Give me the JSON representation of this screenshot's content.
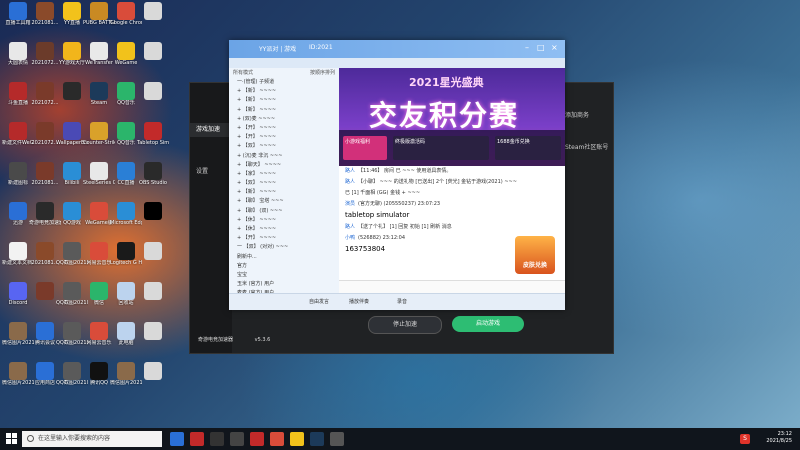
{
  "desktop": {
    "icons": [
      {
        "label": "直播工具箱",
        "color": "#2a6fd6"
      },
      {
        "label": "2021081...",
        "color": "#8a4a2a"
      },
      {
        "label": "YY直播",
        "color": "#f2c21b"
      },
      {
        "label": "PUBG BATTLEGR...",
        "color": "#c98a23"
      },
      {
        "label": "Google Chrome",
        "color": "#d94c3a"
      },
      {
        "label": "",
        "color": "#d9d9d9"
      },
      {
        "label": "大圆表情",
        "color": "#e8e8e8"
      },
      {
        "label": "2021072...",
        "color": "#6b3b2a"
      },
      {
        "label": "YY游戏大厅",
        "color": "#f2b51b"
      },
      {
        "label": "WeTransfer",
        "color": "#e9e9e9"
      },
      {
        "label": "WeGame",
        "color": "#f2c21b"
      },
      {
        "label": "",
        "color": "#d9d9d9"
      },
      {
        "label": "斗鱼直播",
        "color": "#b52a2a"
      },
      {
        "label": "2021072...",
        "color": "#7a3a2a"
      },
      {
        "label": "",
        "color": "#2a2a2a"
      },
      {
        "label": "Steam",
        "color": "#1c3a5a"
      },
      {
        "label": "QQ音乐",
        "color": "#2bb56b"
      },
      {
        "label": "",
        "color": "#d9d9d9"
      },
      {
        "label": "新建文件WeGame",
        "color": "#b52a2a"
      },
      {
        "label": "2021072...",
        "color": "#7a3a2a"
      },
      {
        "label": "WallpaperEngine",
        "color": "#4a4ab5"
      },
      {
        "label": "Counter-Strike",
        "color": "#d9a12a"
      },
      {
        "label": "QQ音乐",
        "color": "#2bb56b"
      },
      {
        "label": "Tabletop Simulator",
        "color": "#c22a2a"
      },
      {
        "label": "新建图标",
        "color": "#4a4a4a"
      },
      {
        "label": "2021081...",
        "color": "#7a3a2a"
      },
      {
        "label": "Bilibili",
        "color": "#2a8ed6"
      },
      {
        "label": "SteelSeries GG",
        "color": "#e8e8e8"
      },
      {
        "label": "CC直播",
        "color": "#2a7fd6"
      },
      {
        "label": "OBS Studio",
        "color": "#2a2a2a"
      },
      {
        "label": "迅游",
        "color": "#2a6fd6"
      },
      {
        "label": "奇游电竞加速器",
        "color": "#2a2a2a"
      },
      {
        "label": "QQ游戏",
        "color": "#2a8ed6"
      },
      {
        "label": "WeGame版",
        "color": "#d94c3a"
      },
      {
        "label": "Microsoft Edge",
        "color": "#2a8ed6"
      },
      {
        "label": "",
        "color": "#000000"
      },
      {
        "label": "新建文本文档.txt",
        "color": "#f2f2f2"
      },
      {
        "label": "2021081...",
        "color": "#8a4a2a"
      },
      {
        "label": "QQ截图2021081...",
        "color": "#5a5a5a"
      },
      {
        "label": "网易云音乐",
        "color": "#d94c3a"
      },
      {
        "label": "Logitech G HUB",
        "color": "#1a1a1a"
      },
      {
        "label": "",
        "color": "#d9d9d9"
      },
      {
        "label": "Discord",
        "color": "#5865f2"
      },
      {
        "label": "",
        "color": "#7a3a2a"
      },
      {
        "label": "QQ截图2021081...",
        "color": "#5a5a5a"
      },
      {
        "label": "微信",
        "color": "#2bb56b"
      },
      {
        "label": "回收站",
        "color": "#bcd3ee"
      },
      {
        "label": "",
        "color": "#d9d9d9"
      },
      {
        "label": "微信图片2021081...",
        "color": "#8a6a4a"
      },
      {
        "label": "腾讯会议",
        "color": "#2a6fd6"
      },
      {
        "label": "QQ截图2021081...",
        "color": "#5a5a5a"
      },
      {
        "label": "网易云音乐",
        "color": "#d94c3a"
      },
      {
        "label": "此电脑",
        "color": "#bcd3ee"
      },
      {
        "label": "",
        "color": "#d9d9d9"
      },
      {
        "label": "微信图片2021081...",
        "color": "#8a6a4a"
      },
      {
        "label": "应用商店",
        "color": "#2a6fd6"
      },
      {
        "label": "QQ截图2021081...",
        "color": "#5a5a5a"
      },
      {
        "label": "腾讯QQ",
        "color": "#111111"
      },
      {
        "label": "微信图片2021081...",
        "color": "#8a6a4a"
      },
      {
        "label": "",
        "color": "#d9d9d9"
      }
    ]
  },
  "accelerator": {
    "nav": [
      "游戏加速",
      "",
      "",
      "设置"
    ],
    "right_panel": [
      "添加商务",
      "Steam社区账号"
    ],
    "stop_label": "停止加速",
    "start_label": "启动游戏",
    "brand": "奇游电竞加速器",
    "version": "v5.3.6"
  },
  "chat": {
    "title": "YY派对 | 游戏",
    "room_id": "ID:2021",
    "left_head_left": "所有模式",
    "left_head_right": "按顺序排列",
    "left_rows": [
      "一·(管理) 子频道",
      "+ 【新】 ~~~~",
      "+ 【新】 ~~~~",
      "+ 【新】 ~~~~",
      "+ (双)麦 ~~~~",
      "+ 【开】 ~~~~",
      "+ 【开】 ~~~~",
      "+ 【双】 ~~~~",
      "+ (沉)麦 非沉 ~~~",
      "+ 【聊天】 ~~~~",
      "+ 【家】 ~~~~",
      "+ 【双】 ~~~~",
      "+ 【新】 ~~~~",
      "+ 【聊】 宝塔 ~~~",
      "+ 【聊】 (双) ~~~",
      "+ 【休】 ~~~~",
      "+ 【休】 ~~~~",
      "+ 【开】 ~~~~",
      "一 【双】 (对对) ~~~",
      "  刷新中...",
      "  官方",
      "  宝宝",
      "  玉米 (官方) 用户",
      "  麦麦 (官方) 用户"
    ],
    "banner_year": "2021星光盛典",
    "banner_main": "交友积分赛",
    "promos": [
      "小游戏福利",
      "终极版激活码",
      "1688金币兑换"
    ],
    "messages": [
      {
        "name": "路人",
        "text": "【11:46】 房间  已 ~~~ 使用道具表情。"
      },
      {
        "name": "路人",
        "text": "【小聊】 ~~~ 的送礼物 [已送出] 2个 [荧光] 金钻于游戏(2021) ~~~"
      },
      {
        "name": "",
        "text": "已 [1] 千面相 (GG) 金钱 + ~~~"
      },
      {
        "name": "演员",
        "text": "(官方无聊) (205550237) 23:07:23"
      },
      {
        "name": "",
        "text": "tabletop simulator",
        "big": true
      },
      {
        "name": "路人",
        "text": "【送了个礼】 [1] 回复  初始 [1] 刷新  消息"
      },
      {
        "name": "小鸭",
        "text": "(526882) 23:12:04"
      },
      {
        "name": "",
        "text": "163753804",
        "big": true
      }
    ],
    "skin_badge": "皮肤兑换",
    "bottom_items": [
      "自由发言",
      "播放伴奏",
      "录音"
    ]
  },
  "taskbar": {
    "search_placeholder": "在这里输入你要搜索的内容",
    "time": "23:12",
    "date": "2021/8/25",
    "ime": "S"
  },
  "colors": {
    "chat_title": "#6ba4e6",
    "start_btn": "#2dbd73",
    "stop_btn": "#2e3136"
  }
}
